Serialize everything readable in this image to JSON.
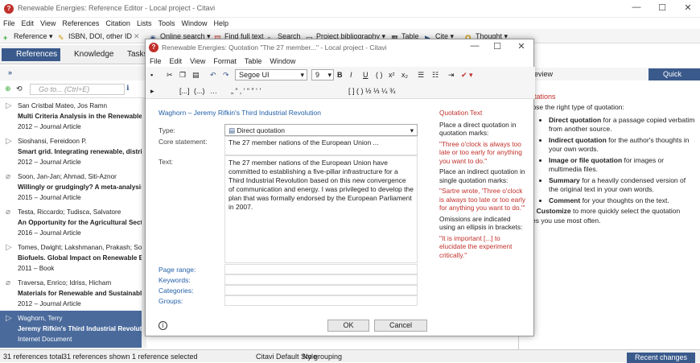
{
  "app": {
    "title": "Renewable Energies: Reference Editor - Local project - Citavi"
  },
  "menu": [
    "File",
    "Edit",
    "View",
    "References",
    "Citation",
    "Lists",
    "Tools",
    "Window",
    "Help"
  ],
  "toolbar": {
    "reference": "Reference",
    "isbn": "ISBN, DOI, other ID",
    "online_search": "Online search",
    "find_full_text": "Find full text",
    "search": "Search",
    "project_bibliography": "Project bibliography",
    "table": "Table",
    "cite": "Cite",
    "thought": "Thought"
  },
  "nav": {
    "references": "References",
    "knowledge": "Knowledge",
    "tasks": "Tasks"
  },
  "goto": {
    "placeholder": "Go to... (Ctrl+E)"
  },
  "references": [
    {
      "authors": "San Cristbal Mateo, Jos Ramn",
      "title": "Multi Criteria Analysis in the Renewable E",
      "meta": "2012 – Journal Article"
    },
    {
      "authors": "Sioshansi, Fereidoon P.",
      "title": "Smart grid. Integrating renewable, distri",
      "meta": "2012 – Journal Article"
    },
    {
      "authors": "Soon, Jan-Jan; Ahmad, Siti-Aznor",
      "title": "Willingly or grudgingly? A meta-analysis o",
      "meta": "2015 – Journal Article"
    },
    {
      "authors": "Testa, Riccardo; Tudisca, Salvatore",
      "title": "An Opportunity for the Agricultural Sect",
      "meta": "2016 – Journal Article"
    },
    {
      "authors": "Tomes, Dwight; Lakshmanan, Prakash; Son",
      "title": "Biofuels. Global Impact on Renewable En",
      "meta": "2011 – Book"
    },
    {
      "authors": "Traversa, Enrico; Idriss, Hicham",
      "title": "Materials for Renewable and Sustainable",
      "meta": "2012 – Journal Article"
    },
    {
      "authors": "Waghorn, Terry",
      "title": "Jeremy Rifkin's Third Industrial Revolutio",
      "meta": "Internet Document"
    }
  ],
  "status": {
    "total": "31 references total",
    "shown": "31 references shown",
    "selected": "1 reference selected",
    "style": "Citavi Default Style",
    "grouping": "No grouping",
    "recent": "Recent changes"
  },
  "right": {
    "tab": "eview",
    "quick_help": "Quick Help",
    "heading": "uotations",
    "intro": "hoose the right type of quotation:",
    "items": [
      {
        "b": "Direct quotation",
        "t": " for a passage copied verbatim from another source."
      },
      {
        "b": "Indirect quotation",
        "t": " for the author's thoughts in your own words."
      },
      {
        "b": "Image or file quotation",
        "t": " for images or multimedia files."
      },
      {
        "b": "Summary",
        "t": " for a heavily condensed version of the original text in your own words."
      },
      {
        "b": "Comment",
        "t": " for your thoughts on the text."
      }
    ],
    "outro_pre": "lick ",
    "outro_b": "Customize",
    "outro_post": " to more quickly select the quotation ypes you use most often."
  },
  "dialog": {
    "title": "Renewable Energies: Quotation \"The 27 member...\" - Local project - Citavi",
    "menu": [
      "File",
      "Edit",
      "View",
      "Format",
      "Table",
      "Window"
    ],
    "font": "Segoe UI",
    "size": "9",
    "ref_link": "Waghorn – Jeremy Rifkin's Third Industrial Revolution",
    "type_label": "Type:",
    "type_value": "Direct quotation",
    "core_label": "Core statement:",
    "core_value": "The 27 member nations of the European Union ...",
    "text_label": "Text:",
    "text_value": "The 27 member nations of the European Union have committed to establishing a five-pillar infrastructure for a Third Industrial Revolution based on this new convergence of communication and energy. I was privileged to develop the plan that was formally endorsed by the European Parliament in 2007.",
    "page_range": "Page range:",
    "keywords": "Keywords:",
    "categories": "Categories:",
    "groups": "Groups:",
    "ok": "OK",
    "cancel": "Cancel",
    "side": {
      "head": "Quotation Text",
      "p1": "Place a direct quotation in quotation marks:",
      "ex1": "\"Three o'clock is always too late or too early for anything you want to do.\"",
      "p2": "Place an indirect quotation in single quotation marks:",
      "ex2": "\"Sartre wrote, 'Three o'clock is always too late or too early for anything you want to do.'\"",
      "p3": "Omissions are indicated using an ellipsis in brackets:",
      "ex3": "\"It is important [...] to elucidate the experiment critically.\""
    }
  },
  "colors": {
    "accent": "#3a5a8c",
    "red": "#c0302b",
    "link": "#2460a8"
  }
}
